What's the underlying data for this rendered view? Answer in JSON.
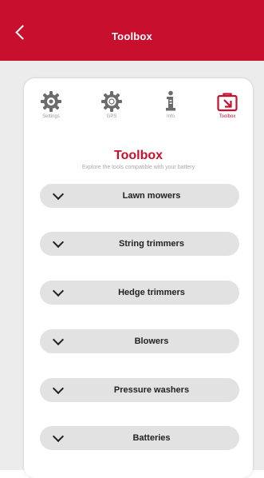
{
  "header": {
    "title": "Toolbox"
  },
  "tabs": [
    {
      "label": "Settings",
      "icon": "gear-icon"
    },
    {
      "label": "GPS",
      "icon": "gps-gear-icon"
    },
    {
      "label": "Info",
      "icon": "info-icon"
    },
    {
      "label": "Toolbox",
      "icon": "toolbox-icon"
    }
  ],
  "section": {
    "title": "Toolbox",
    "subtitle": "Explore the tools compatible with your battery"
  },
  "categories": [
    "Lawn mowers",
    "String trimmers",
    "Hedge trimmers",
    "Blowers",
    "Pressure washers",
    "Batteries"
  ],
  "colors": {
    "brand": "#c8102e",
    "background": "#ececec",
    "pill": "#e2e2e2"
  }
}
